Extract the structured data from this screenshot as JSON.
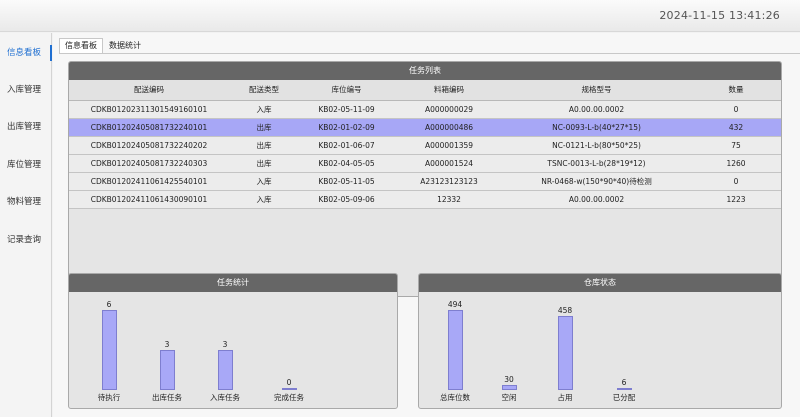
{
  "header": {
    "datetime": "2024-11-15 13:41:26"
  },
  "sidebar": {
    "items": [
      {
        "label": "信息看板",
        "active": true
      },
      {
        "label": "入库管理",
        "active": false
      },
      {
        "label": "出库管理",
        "active": false
      },
      {
        "label": "库位管理",
        "active": false
      },
      {
        "label": "物料管理",
        "active": false
      },
      {
        "label": "记录查询",
        "active": false
      }
    ]
  },
  "tabs": [
    {
      "label": "信息看板",
      "active": true
    },
    {
      "label": "数据统计",
      "active": false
    }
  ],
  "task_list": {
    "title": "任务列表",
    "columns": [
      "配送编码",
      "配送类型",
      "库位编号",
      "料箱编码",
      "规格型号",
      "数量"
    ],
    "rows": [
      [
        "CDKB0120231130154916 0101",
        "入库",
        "KB02-05-11-09",
        "A000000029",
        "A0.00.00.0002",
        "0"
      ],
      [
        "CDKB01202405081732240101",
        "出库",
        "KB02-01-02-09",
        "A000000486",
        "NC-0093-L-b(40*27*15)",
        "432"
      ],
      [
        "CDKB01202405081732240202",
        "出库",
        "KB02-01-06-07",
        "A000001359",
        "NC-0121-L-b(80*50*25)",
        "75"
      ],
      [
        "CDKB01202405081732240303",
        "出库",
        "KB02-04-05-05",
        "A000001524",
        "TSNC-0013-L-b(28*19*12)",
        "1260"
      ],
      [
        "CDKB01202411061425540101",
        "入库",
        "KB02-05-11-05",
        "A23123123123",
        "NR-0468-w(150*90*40)待检测",
        "0"
      ],
      [
        "CDKB01202411061430090101",
        "入库",
        "KB02-05-09-06",
        "12332",
        "A0.00.00.0002",
        "1223"
      ]
    ],
    "selected_row": 1
  },
  "task_stats": {
    "title": "任务统计",
    "chart_data": {
      "type": "bar",
      "categories": [
        "待执行",
        "出库任务",
        "入库任务",
        "完成任务"
      ],
      "values": [
        6,
        3,
        3,
        0
      ],
      "ylim": [
        0,
        6
      ]
    }
  },
  "warehouse_status": {
    "title": "仓库状态",
    "chart_data": {
      "type": "bar",
      "categories": [
        "总库位数",
        "空闲",
        "占用",
        "已分配"
      ],
      "values": [
        494,
        30,
        458,
        6
      ],
      "ylim": [
        0,
        494
      ]
    }
  },
  "colors": {
    "bar_fill": "#a8a8f7",
    "selected_row": "#a7a7f6",
    "panel_header": "#666666",
    "active_accent": "#1f6fd1"
  }
}
